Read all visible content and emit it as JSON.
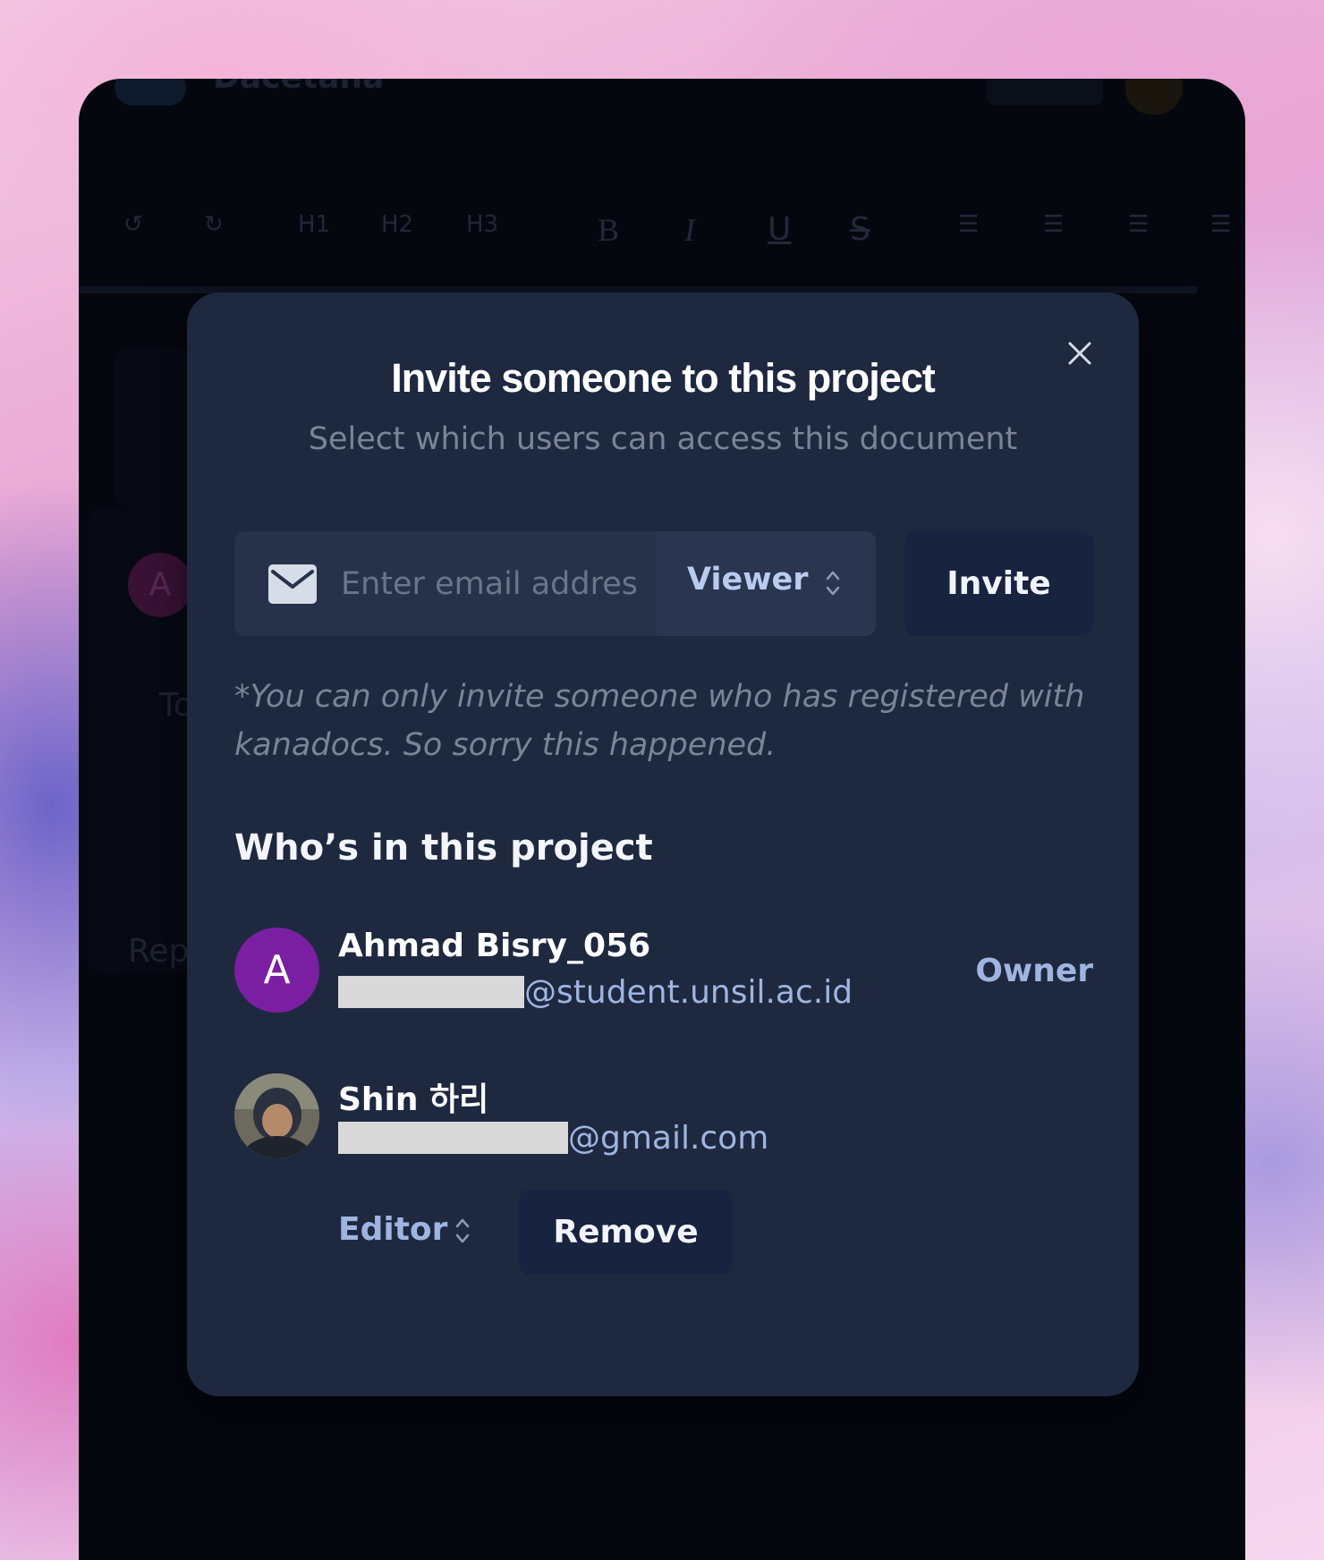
{
  "background_app": {
    "title": "Dacetana",
    "toolbar": [
      "H1",
      "H2",
      "H3",
      "B",
      "I",
      "U",
      "S"
    ],
    "avatar_letter": "A",
    "text_fragments": [
      "To",
      "Rep"
    ]
  },
  "modal": {
    "title": "Invite someone to this project",
    "subtitle": "Select which users can access this document",
    "email_placeholder": "Enter email address",
    "email_value": "",
    "role_selected": "Viewer",
    "invite_label": "Invite",
    "note": "*You can only invite someone who has registered with kanadocs. So sorry this happened.",
    "members_heading": "Who’s in this project",
    "members": [
      {
        "avatar_letter": "A",
        "name": "Ahmad Bisry_056",
        "email_domain": "@student.unsil.ac.id",
        "role": "Owner"
      },
      {
        "name": "Shin 하리",
        "email_domain": "@gmail.com",
        "role_selected": "Editor",
        "remove_label": "Remove"
      }
    ]
  },
  "colors": {
    "modal_bg": "#1e2940",
    "button_bg": "#17233f",
    "accent_text": "#9fb5e0",
    "avatar_purple": "#7b1fa2"
  },
  "icons": [
    "close-icon",
    "mail-icon",
    "chevron-updown-icon"
  ]
}
